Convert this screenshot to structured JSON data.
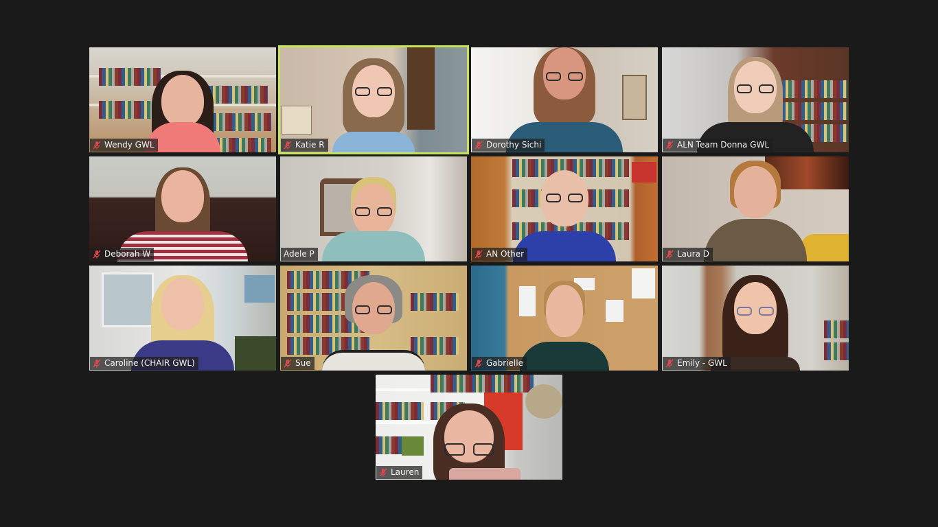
{
  "app": {
    "view": "Gallery View"
  },
  "colors": {
    "background": "#1a1a1a",
    "active_speaker_border": "#c6e35a",
    "muted_icon": "#e0474c",
    "label_text": "#f2f2f2"
  },
  "participants": [
    {
      "name": "Wendy GWL",
      "muted": true,
      "active_speaker": false,
      "mic_icon": "mic-muted-icon"
    },
    {
      "name": "Katie R",
      "muted": true,
      "active_speaker": true,
      "mic_icon": "mic-muted-icon"
    },
    {
      "name": "Dorothy Sichi",
      "muted": true,
      "active_speaker": false,
      "mic_icon": "mic-muted-icon"
    },
    {
      "name": "ALN Team Donna GWL",
      "muted": true,
      "active_speaker": false,
      "mic_icon": "mic-muted-icon"
    },
    {
      "name": "Deborah W",
      "muted": true,
      "active_speaker": false,
      "mic_icon": "mic-muted-icon"
    },
    {
      "name": "Adele P",
      "muted": false,
      "active_speaker": false,
      "mic_icon": ""
    },
    {
      "name": "AN Other",
      "muted": true,
      "active_speaker": false,
      "mic_icon": "mic-muted-icon"
    },
    {
      "name": "Laura D",
      "muted": true,
      "active_speaker": false,
      "mic_icon": "mic-muted-icon"
    },
    {
      "name": "Caroline (CHAIR GWL)",
      "muted": true,
      "active_speaker": false,
      "mic_icon": "mic-muted-icon"
    },
    {
      "name": "Sue",
      "muted": true,
      "active_speaker": false,
      "mic_icon": "mic-muted-icon"
    },
    {
      "name": "Gabrielle",
      "muted": true,
      "active_speaker": false,
      "mic_icon": "mic-muted-icon"
    },
    {
      "name": "Emily - GWL",
      "muted": true,
      "active_speaker": false,
      "mic_icon": "mic-muted-icon"
    },
    {
      "name": "Lauren",
      "muted": true,
      "active_speaker": false,
      "mic_icon": "mic-muted-icon"
    }
  ]
}
